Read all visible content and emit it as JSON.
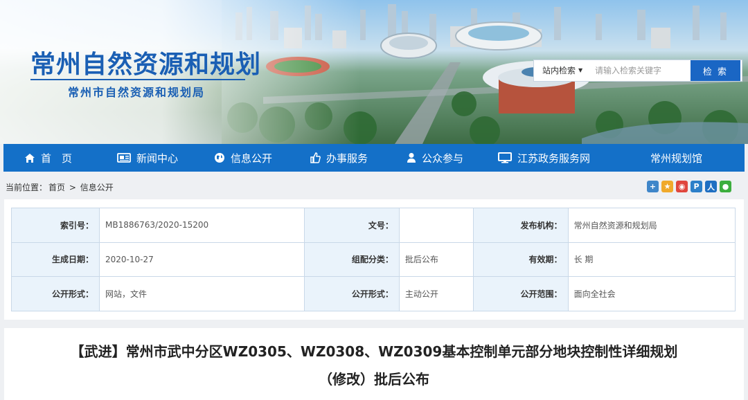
{
  "header": {
    "title": "常州自然资源和规划",
    "subtitle": "常州市自然资源和规划局"
  },
  "search": {
    "scope": "站内检索",
    "placeholder": "请输入检索关键字",
    "button": "检 索"
  },
  "nav": {
    "items": [
      {
        "label": "首　页",
        "icon": "home-icon"
      },
      {
        "label": "新闻中心",
        "icon": "newspaper-icon"
      },
      {
        "label": "信息公开",
        "icon": "globe-icon"
      },
      {
        "label": "办事服务",
        "icon": "thumbs-up-icon"
      },
      {
        "label": "公众参与",
        "icon": "user-icon"
      },
      {
        "label": "江苏政务服务网",
        "icon": "monitor-icon"
      },
      {
        "label": "常州规划馆",
        "icon": ""
      }
    ]
  },
  "breadcrumb": {
    "prefix": "当前位置：",
    "home": "首页",
    "sep": ">",
    "current": "信息公开"
  },
  "share": {
    "icons": [
      "plus-share-icon",
      "qzone-icon",
      "weibo-icon",
      "tencent-weibo-icon",
      "renren-icon",
      "wechat-icon"
    ],
    "colors": [
      "#3f86c9",
      "#f0a92b",
      "#e0463d",
      "#2b7fc9",
      "#1f6fc2",
      "#3cae3e"
    ]
  },
  "info": {
    "rows": [
      [
        {
          "key": "索引号：",
          "value": "MB1886763/2020-15200"
        },
        {
          "key": "文号：",
          "value": ""
        },
        {
          "key": "发布机构：",
          "value": "常州自然资源和规划局"
        }
      ],
      [
        {
          "key": "生成日期：",
          "value": "2020-10-27"
        },
        {
          "key": "组配分类：",
          "value": "批后公布"
        },
        {
          "key": "有效期：",
          "value": "长 期"
        }
      ],
      [
        {
          "key": "公开形式：",
          "value": "网站，文件"
        },
        {
          "key": "公开形式：",
          "value": "主动公开"
        },
        {
          "key": "公开范围：",
          "value": "面向全社会"
        }
      ]
    ]
  },
  "article": {
    "title_line1": "【武进】常州市武中分区WZ0305、WZ0308、WZ0309基本控制单元部分地块控制性详细规划",
    "title_line2": "（修改）批后公布"
  }
}
